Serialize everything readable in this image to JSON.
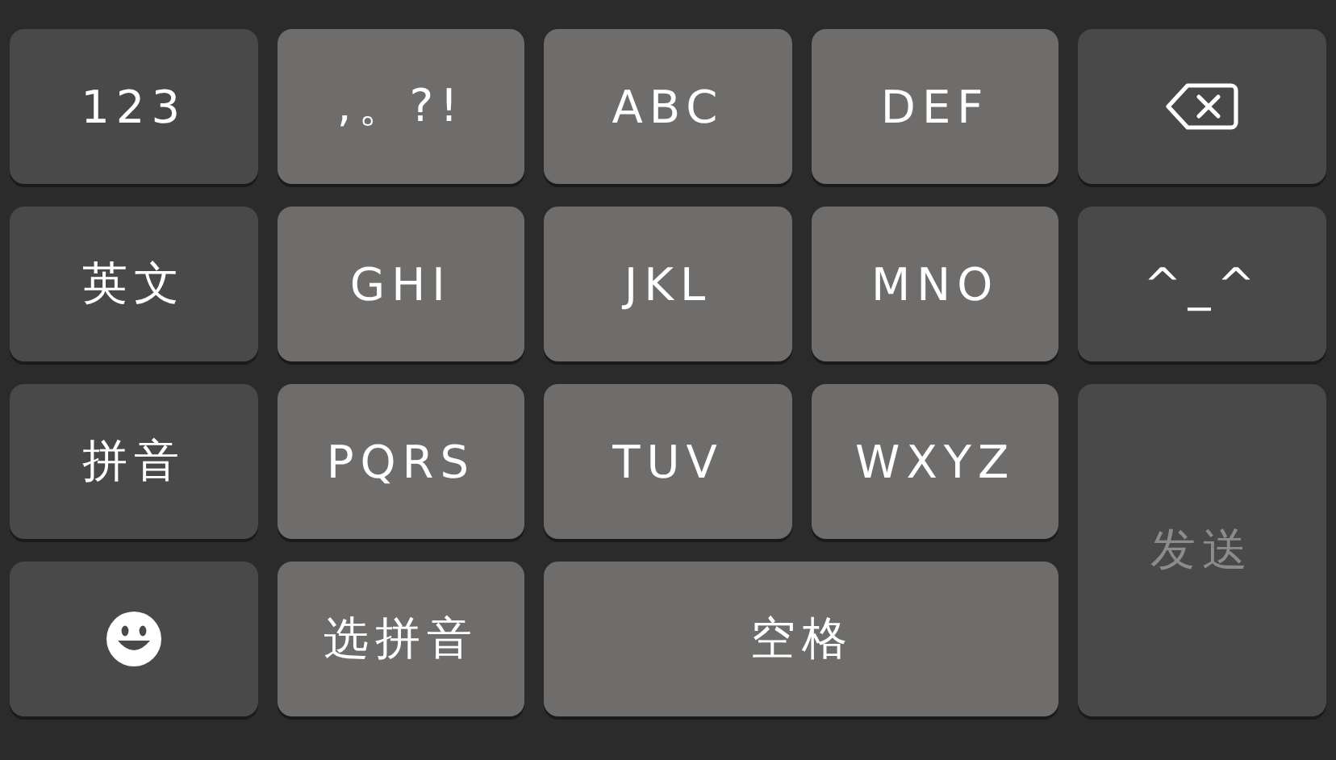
{
  "keys": [
    {
      "kind": "function",
      "label": "123"
    },
    {
      "kind": "character",
      "label": ",。?!"
    },
    {
      "kind": "character",
      "label": "ABC"
    },
    {
      "kind": "character",
      "label": "DEF"
    },
    {
      "kind": "delete"
    },
    {
      "kind": "function",
      "label": "英文"
    },
    {
      "kind": "character",
      "label": "GHI"
    },
    {
      "kind": "character",
      "label": "JKL"
    },
    {
      "kind": "character",
      "label": "MNO"
    },
    {
      "kind": "function",
      "label": "^_^"
    },
    {
      "kind": "function",
      "label": "拼音"
    },
    {
      "kind": "character",
      "label": "PQRS"
    },
    {
      "kind": "character",
      "label": "TUV"
    },
    {
      "kind": "character",
      "label": "WXYZ"
    },
    {
      "kind": "send",
      "label": "发送",
      "disabled": true
    },
    {
      "kind": "emoji"
    },
    {
      "kind": "character",
      "label": "选拼音"
    },
    {
      "kind": "space",
      "label": "空格"
    }
  ]
}
